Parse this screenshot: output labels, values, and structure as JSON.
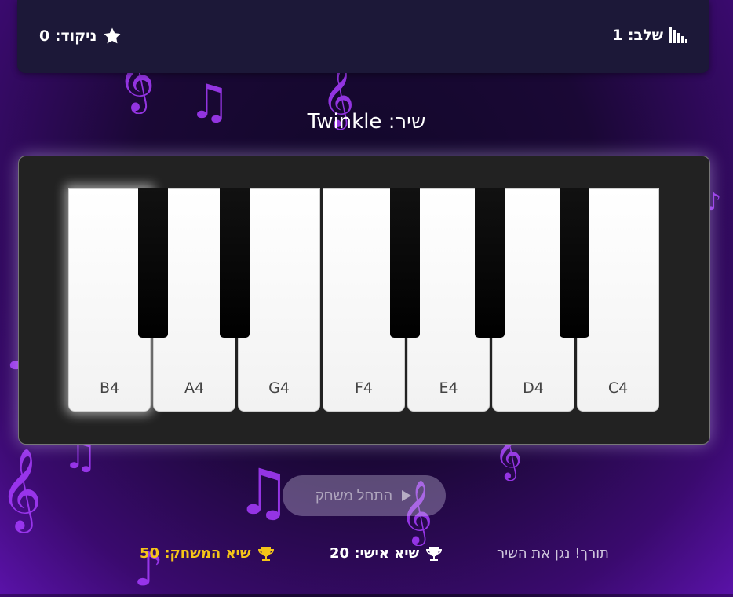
{
  "header": {
    "level_label": "שלב: 1",
    "score_label": "ניקוד: 0"
  },
  "song": {
    "title": "שיר: Twinkle"
  },
  "piano": {
    "white_keys": [
      "B4",
      "A4",
      "G4",
      "F4",
      "E4",
      "D4",
      "C4"
    ]
  },
  "controls": {
    "start_label": "התחל משחק"
  },
  "footer": {
    "hint": "תורך! נגן את השיר",
    "personal_best": "שיא אישי: 20",
    "game_best": "שיא המשחק: 50"
  },
  "colors": {
    "accent_purple": "#a83cff",
    "gold": "#f5c518",
    "topbar_bg": "#1c1838"
  },
  "icons": {
    "level": "signal-bars-icon",
    "score": "star-icon",
    "start": "play-icon",
    "trophy": "trophy-icon"
  }
}
